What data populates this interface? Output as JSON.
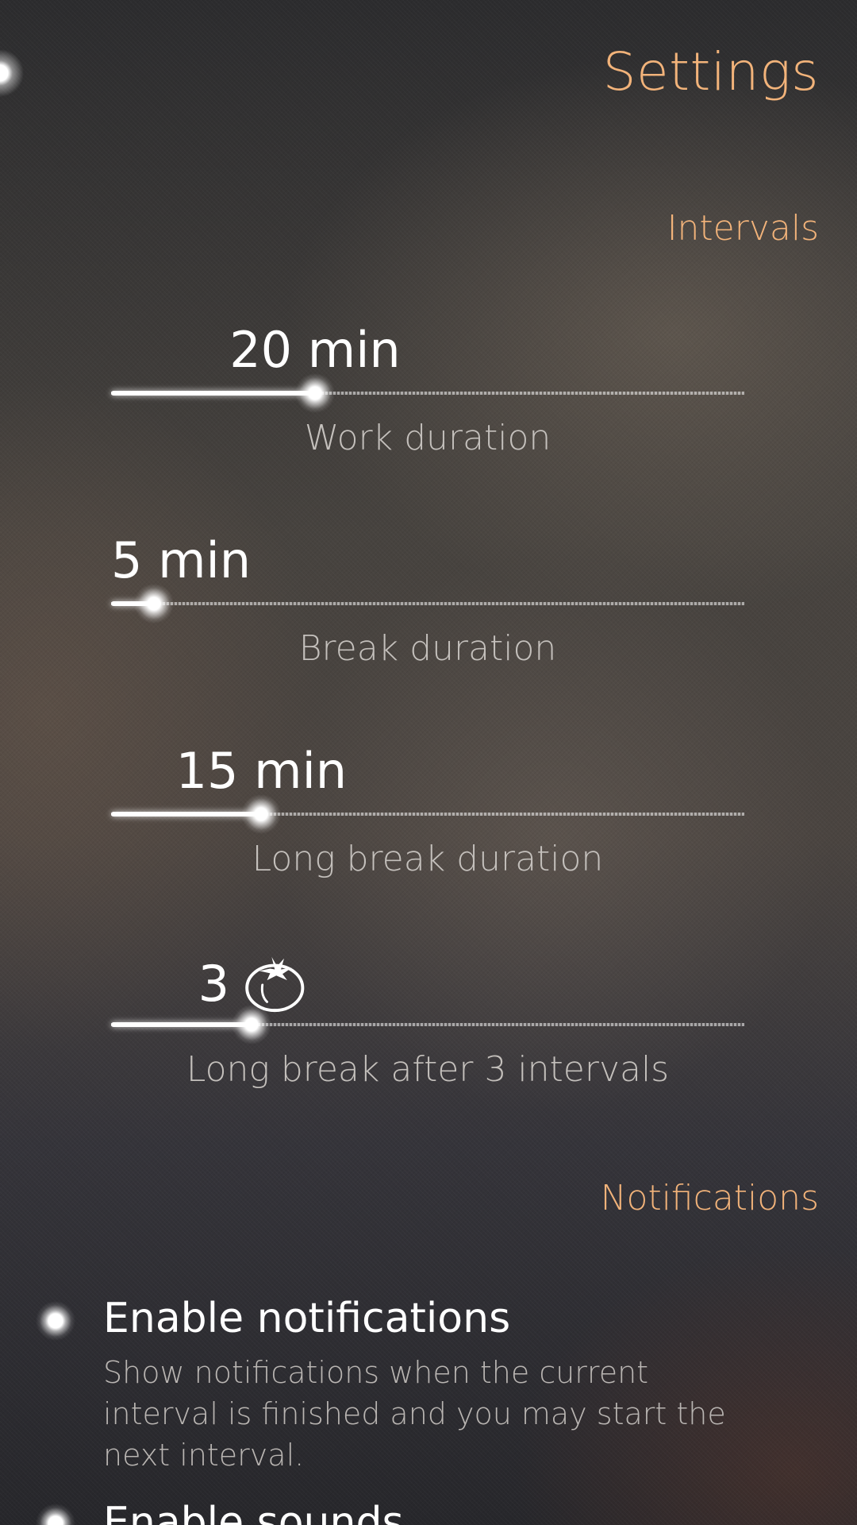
{
  "page": {
    "title": "Settings"
  },
  "intervals": {
    "header": "Intervals",
    "sliders": [
      {
        "value_text": "20 min",
        "label": "Work duration",
        "value": 20,
        "min": 1,
        "max": 60
      },
      {
        "value_text": "5 min",
        "label": "Break duration",
        "value": 5,
        "min": 1,
        "max": 60
      },
      {
        "value_text": "15 min",
        "label": "Long break duration",
        "value": 15,
        "min": 1,
        "max": 60
      },
      {
        "value_text": "3",
        "label": "Long break after 3 intervals",
        "value": 3,
        "min": 1,
        "max": 10,
        "icon": "tomato-icon"
      }
    ]
  },
  "notifications": {
    "header": "Notifications",
    "items": [
      {
        "title": "Enable notifications",
        "description": "Show notifications when the current interval is finished and you may start the next interval.",
        "checked": true
      },
      {
        "title": "Enable sounds",
        "checked": true
      }
    ]
  },
  "colors": {
    "accent": "#f2b37a",
    "primary_text": "#ffffff",
    "secondary_text": "#c4c0bc"
  }
}
